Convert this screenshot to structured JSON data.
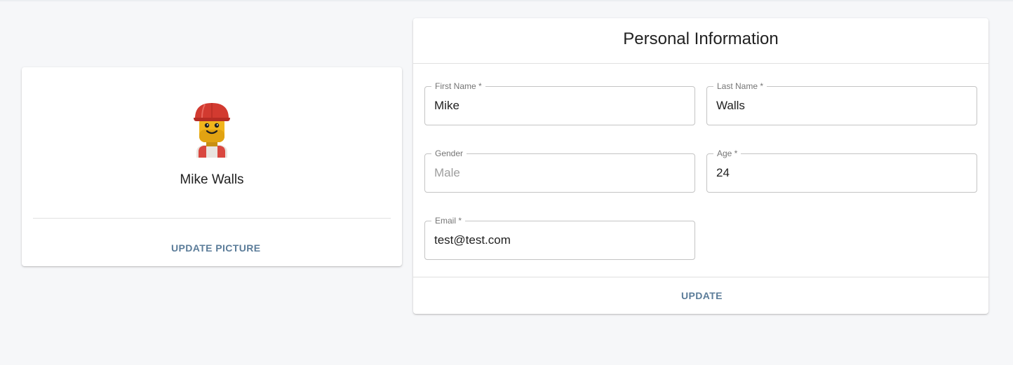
{
  "profile": {
    "name": "Mike Walls",
    "avatar_icon": "lego-minifigure-hardhat",
    "update_picture_label": "UPDATE PICTURE"
  },
  "personal_info": {
    "title": "Personal Information",
    "fields": {
      "first_name": {
        "label": "First Name *",
        "value": "Mike"
      },
      "last_name": {
        "label": "Last Name *",
        "value": "Walls"
      },
      "gender": {
        "label": "Gender",
        "value": "Male"
      },
      "age": {
        "label": "Age *",
        "value": "24"
      },
      "email": {
        "label": "Email *",
        "value": "test@test.com"
      }
    },
    "update_label": "UPDATE"
  },
  "colors": {
    "background": "#f6f7f9",
    "card": "#ffffff",
    "accent": "#5b7c99",
    "border": "#c4c4c4"
  }
}
